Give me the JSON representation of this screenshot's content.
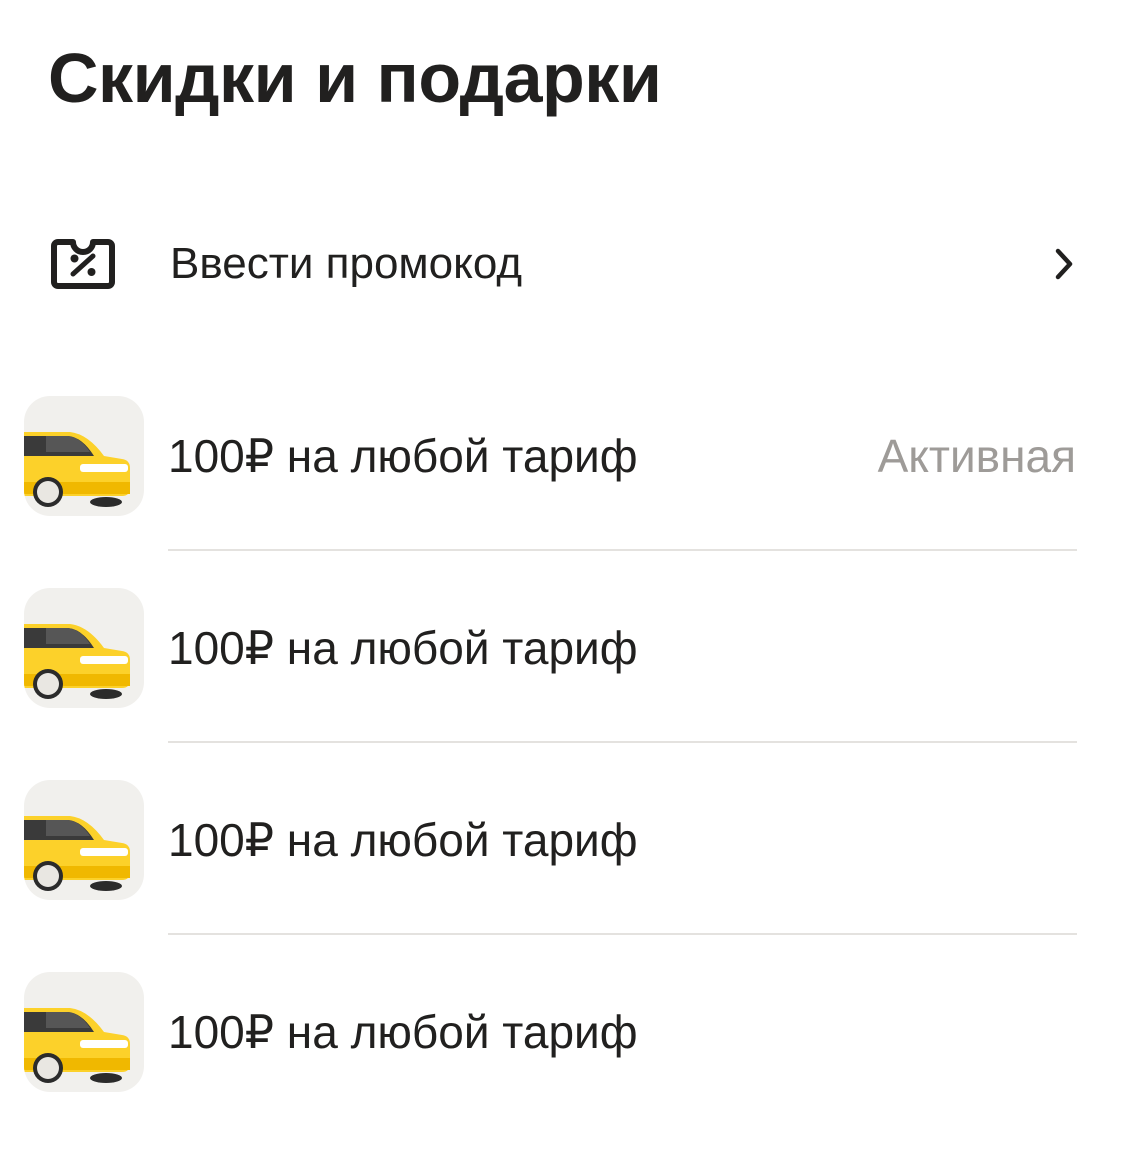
{
  "page": {
    "title": "Скидки и подарки"
  },
  "promo": {
    "label": "Ввести промокод",
    "icon": "promo-ticket-percent-icon",
    "chevron_icon": "chevron-right-icon"
  },
  "gifts": [
    {
      "label": "100₽ на любой тариф",
      "status": "Активная",
      "icon": "yellow-taxi-car-icon"
    },
    {
      "label": "100₽ на любой тариф",
      "status": "",
      "icon": "yellow-taxi-car-icon"
    },
    {
      "label": "100₽ на любой тариф",
      "status": "",
      "icon": "yellow-taxi-car-icon"
    },
    {
      "label": "100₽ на любой тариф",
      "status": "",
      "icon": "yellow-taxi-car-icon"
    }
  ],
  "colors": {
    "text_primary": "#21201f",
    "text_secondary": "#9e9b98",
    "tile_background": "#f1f0ed",
    "taxi_yellow": "#fcd12a",
    "divider": "#e4e2df"
  }
}
